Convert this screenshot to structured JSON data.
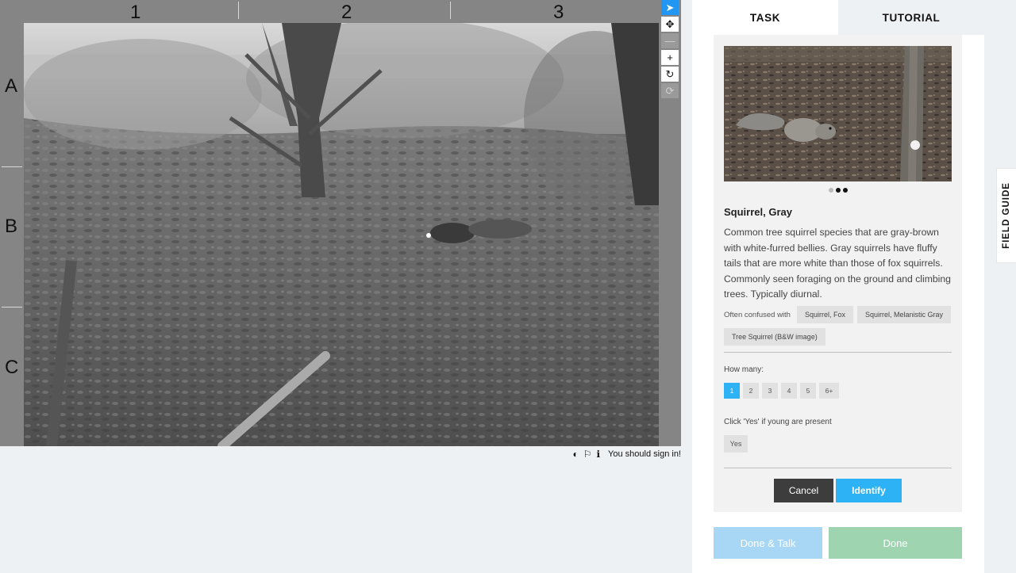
{
  "viewer": {
    "grid_columns": [
      "1",
      "2",
      "3"
    ],
    "grid_rows": [
      "A",
      "B",
      "C"
    ],
    "tools": [
      {
        "icon": "pointer-icon",
        "glyph": "➤",
        "state": "active"
      },
      {
        "icon": "move-icon",
        "glyph": "✥",
        "state": "normal"
      },
      {
        "icon": "zoom-out-icon",
        "glyph": "—",
        "state": "disabled"
      },
      {
        "icon": "zoom-in-icon",
        "glyph": "+",
        "state": "normal"
      },
      {
        "icon": "rotate-icon",
        "glyph": "↻",
        "state": "normal"
      },
      {
        "icon": "reset-icon",
        "glyph": "⟳",
        "state": "disabled"
      }
    ],
    "meta": {
      "contrast_icon": "◐",
      "flag_icon": "⚐",
      "info_icon": "ℹ",
      "signin_text": "You should sign in!"
    }
  },
  "tabs": {
    "task": "TASK",
    "tutorial": "TUTORIAL"
  },
  "species": {
    "name": "Squirrel, Gray",
    "description": "Common tree squirrel species that are gray-brown with white-furred bellies. Gray squirrels have fluffy tails that are more white than those of fox squirrels. Commonly seen foraging on the ground and climbing trees. Typically diurnal.",
    "confused_label": "Often confused with",
    "confused_with": [
      "Squirrel, Fox",
      "Squirrel, Melanistic Gray",
      "Tree Squirrel (B&W image)"
    ],
    "photo_dots": 3,
    "active_dot": 1
  },
  "questions": {
    "how_many_label": "How many:",
    "counts": [
      "1",
      "2",
      "3",
      "4",
      "5",
      "6+"
    ],
    "selected_count": "1",
    "young_label": "Click 'Yes' if young are present",
    "yes_label": "Yes"
  },
  "actions": {
    "cancel": "Cancel",
    "identify": "Identify",
    "done_talk": "Done & Talk",
    "done": "Done"
  },
  "field_guide": "FIELD GUIDE",
  "colors": {
    "accent": "#2db3f5",
    "tool_active": "#2196f3",
    "cancel_bg": "#3d3d3d",
    "done_talk_bg": "#a8d7f5",
    "done_bg": "#9ed5b0"
  }
}
